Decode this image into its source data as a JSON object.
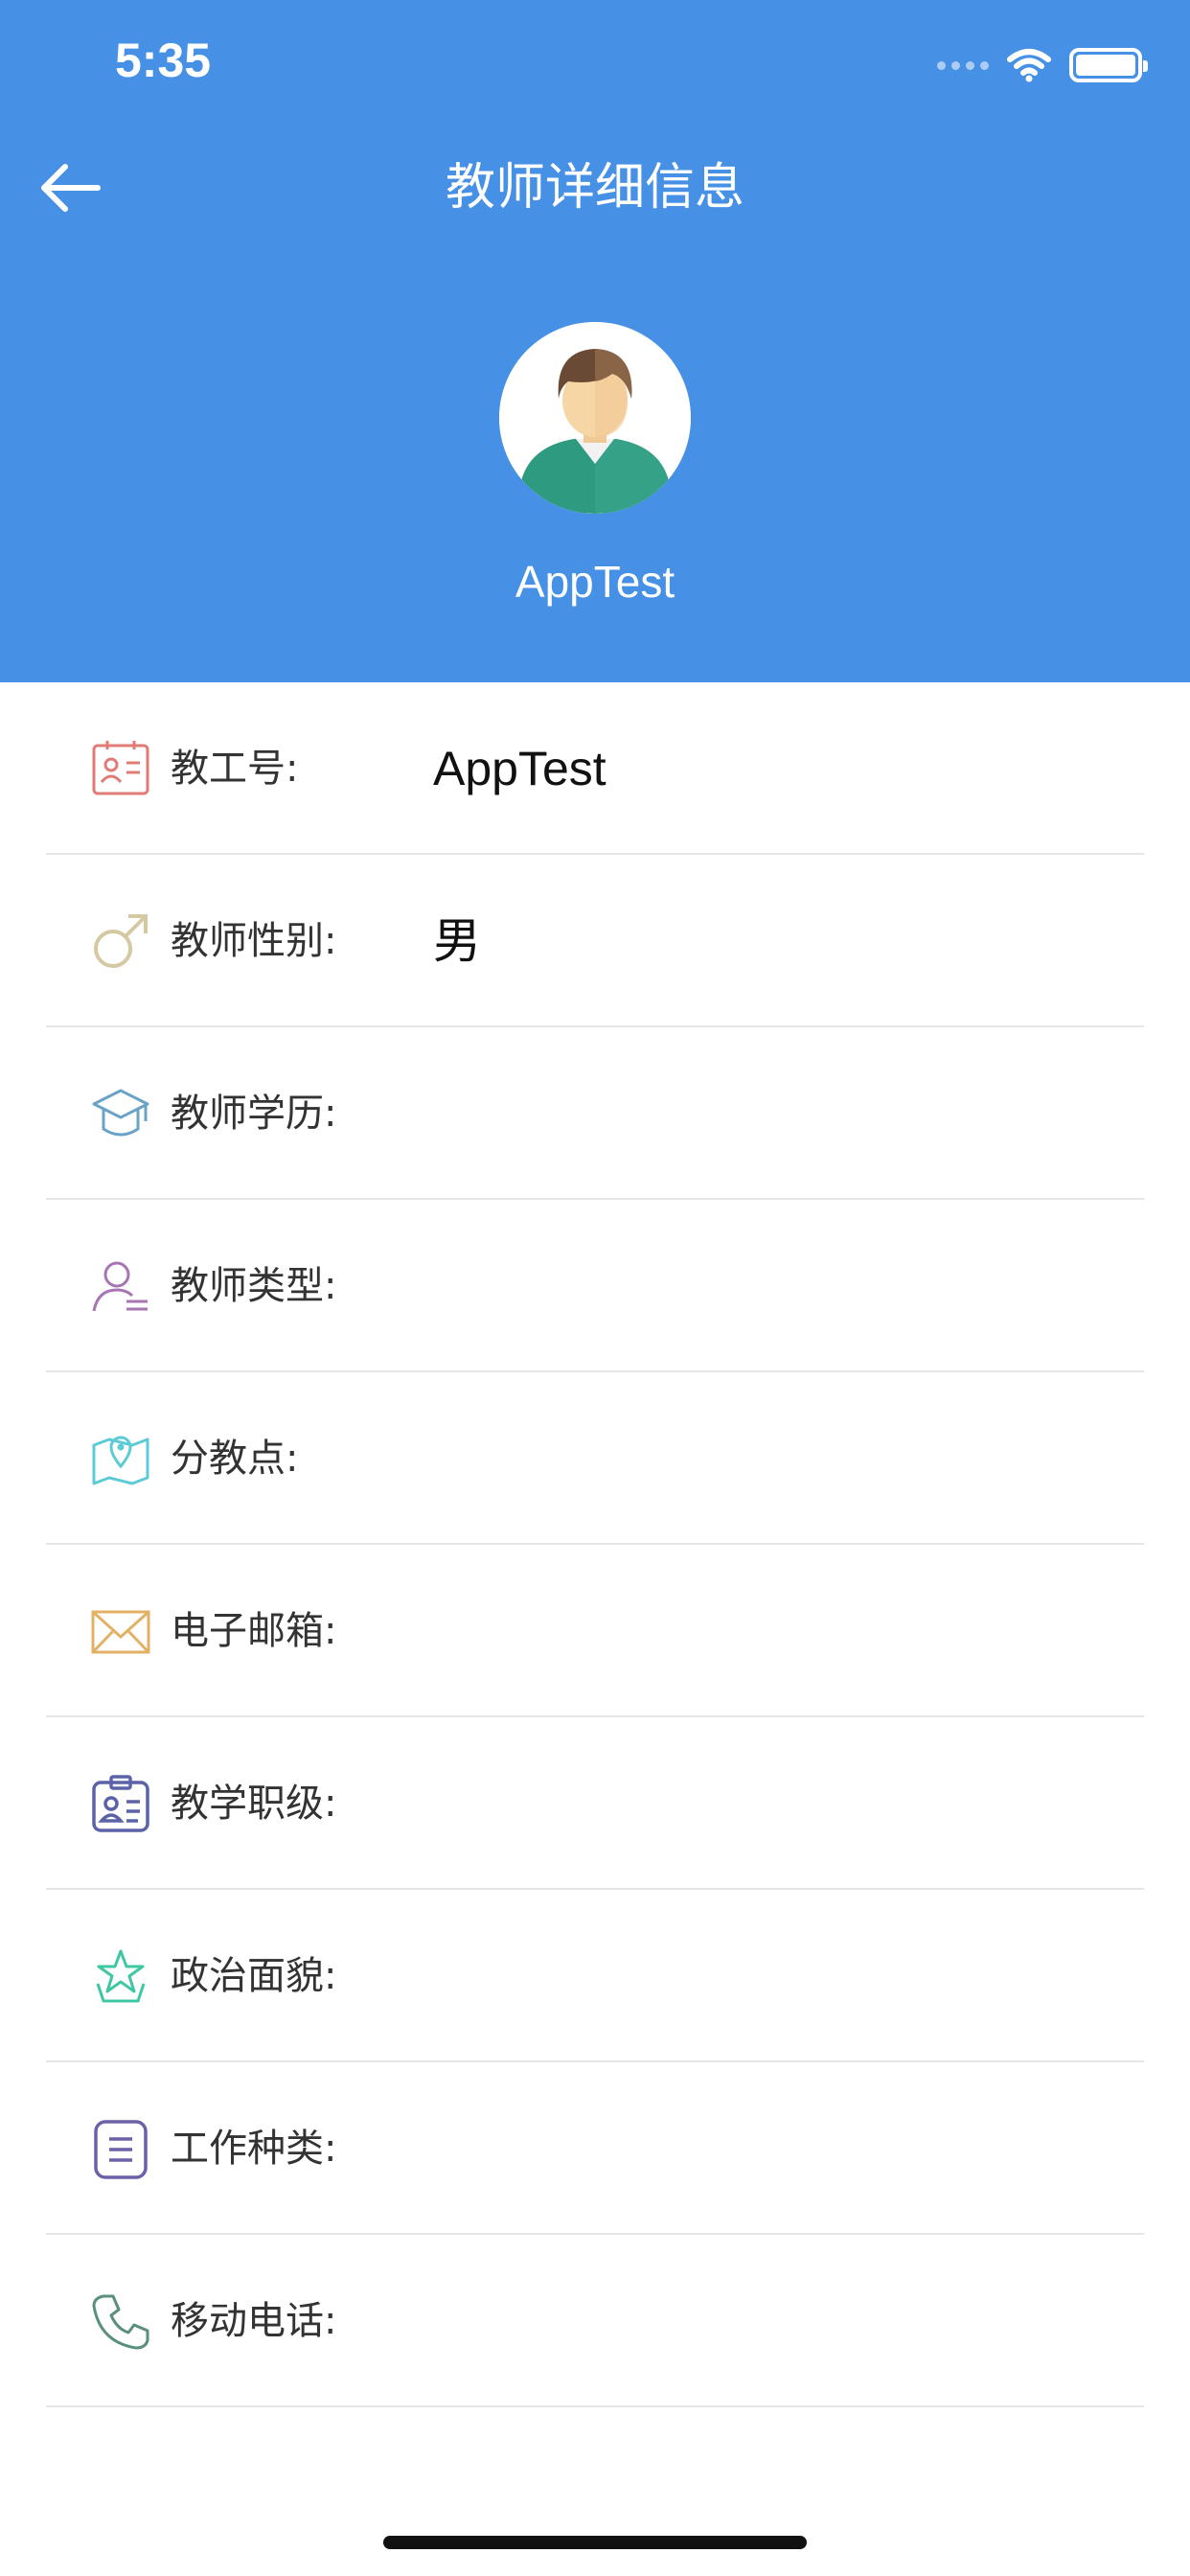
{
  "status_bar": {
    "time": "5:35"
  },
  "header": {
    "title": "教师详细信息",
    "back_icon": "arrow-left-icon"
  },
  "profile": {
    "name": "AppTest",
    "avatar_icon": "person-avatar-icon"
  },
  "fields": [
    {
      "label": "教工号:",
      "value": "AppTest",
      "icon": "id-card-icon",
      "color": "#e07b76"
    },
    {
      "label": "教师性别:",
      "value": "男",
      "icon": "male-symbol-icon",
      "color": "#d4c9a3"
    },
    {
      "label": "教师学历:",
      "value": "",
      "icon": "graduation-cap-icon",
      "color": "#6aa3c8"
    },
    {
      "label": "教师类型:",
      "value": "",
      "icon": "user-list-icon",
      "color": "#a775b3"
    },
    {
      "label": "分教点:",
      "value": "",
      "icon": "map-pin-icon",
      "color": "#5ccbd6"
    },
    {
      "label": "电子邮箱:",
      "value": "",
      "icon": "envelope-icon",
      "color": "#e3b165"
    },
    {
      "label": "教学职级:",
      "value": "",
      "icon": "badge-icon",
      "color": "#5b62a8"
    },
    {
      "label": "政治面貌:",
      "value": "",
      "icon": "star-icon",
      "color": "#3fc7a3"
    },
    {
      "label": "工作种类:",
      "value": "",
      "icon": "document-icon",
      "color": "#6a61a8"
    },
    {
      "label": "移动电话:",
      "value": "",
      "icon": "phone-icon",
      "color": "#5a8f7d"
    }
  ],
  "colors": {
    "header_bg": "#4690e6",
    "divider": "#e6e6e6"
  }
}
